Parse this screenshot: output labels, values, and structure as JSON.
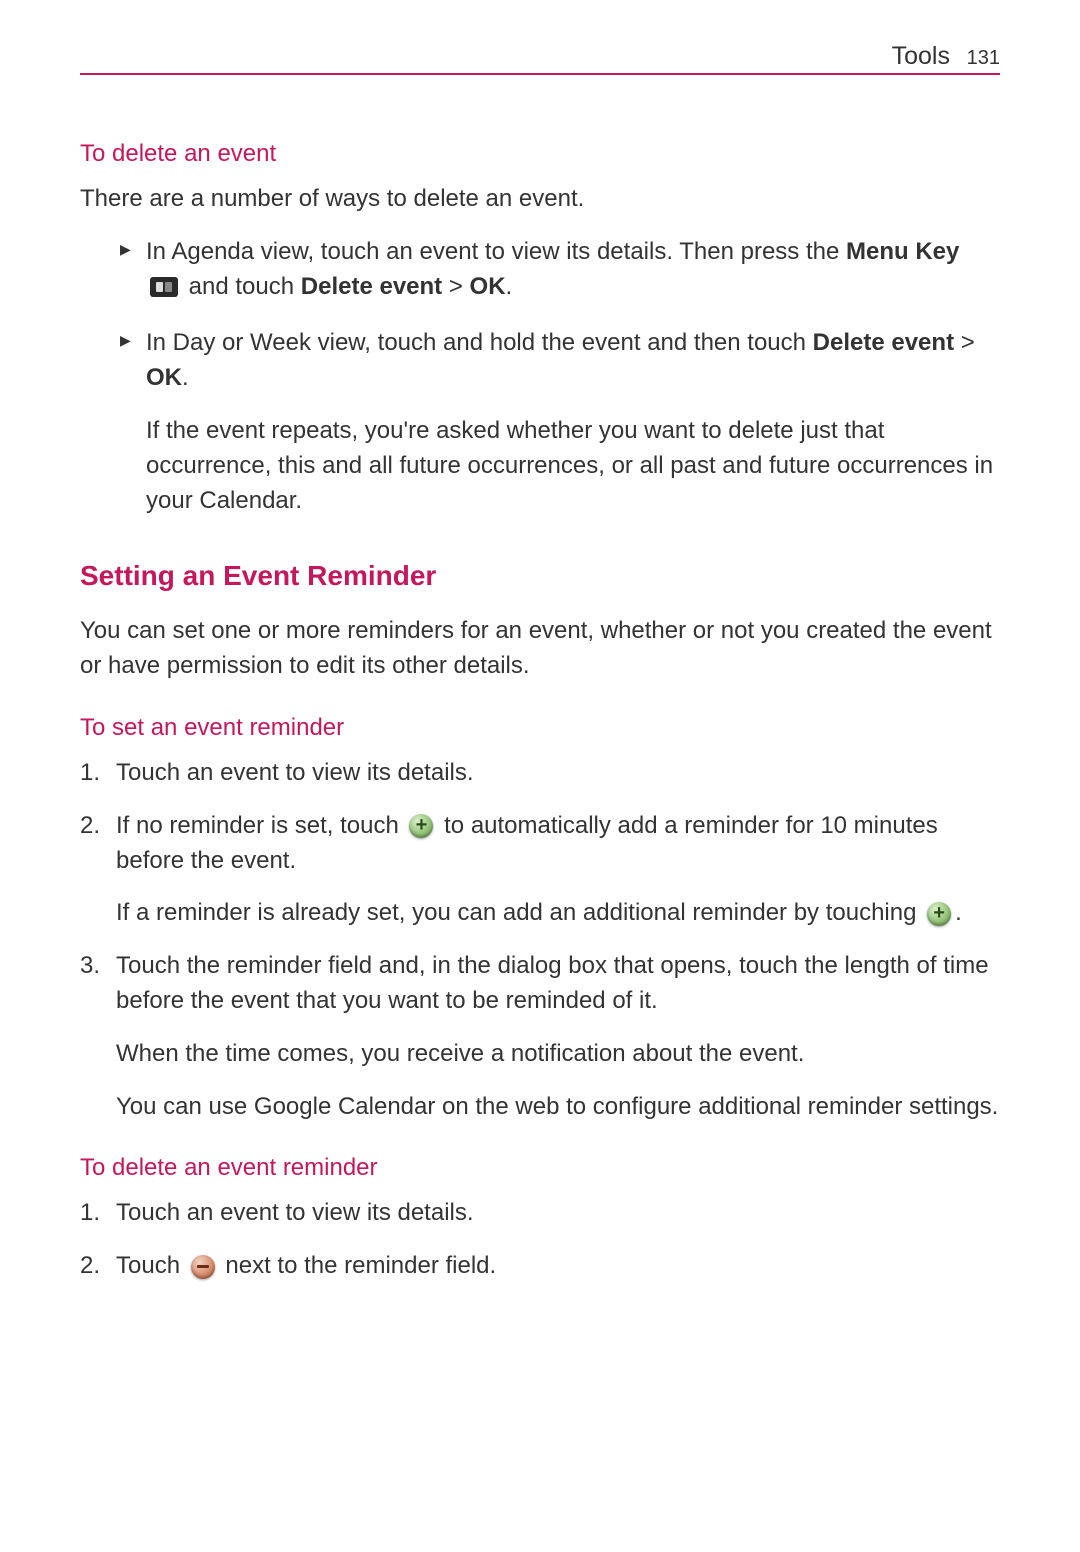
{
  "header": {
    "section": "Tools",
    "page_number": "131"
  },
  "sections": {
    "delete_event": {
      "heading": "To delete an event",
      "intro": "There are a number of ways to delete an event.",
      "bullets": {
        "b1": {
          "p1a": "In Agenda view, touch an event to view its details. Then press the ",
          "p1b": "Menu Key",
          "p1c": " and touch ",
          "p1d": "Delete event",
          "p1e": " > ",
          "p1f": "OK",
          "p1g": "."
        },
        "b2": {
          "p1a": "In Day or Week view, touch and hold the event and then touch ",
          "p1b": "Delete event",
          "p1c": " > ",
          "p1d": "OK",
          "p1e": ".",
          "p2": "If the event repeats, you're asked whether you want to delete just that occurrence, this and all future occurrences, or all past and future occurrences in your Calendar."
        }
      }
    },
    "setting_reminder": {
      "heading": "Setting an Event Reminder",
      "intro": "You can set one or more reminders for an event, whether or not you created the event or have permission to edit its other details."
    },
    "set_reminder": {
      "heading": "To set an event reminder",
      "items": {
        "i1": "Touch an event to view its details.",
        "i2": {
          "p1a": "If no reminder is set, touch ",
          "p1b": " to automatically add a reminder for 10 minutes before the event.",
          "p2a": "If a reminder is already set, you can add an additional reminder by touching ",
          "p2b": "."
        },
        "i3": {
          "p1": "Touch the reminder field and, in the dialog box that opens, touch the length of time before the event that you want to be reminded of it.",
          "p2": "When the time comes, you receive a notification about the event.",
          "p3": "You can use Google Calendar on the web to configure additional reminder settings."
        }
      }
    },
    "delete_reminder": {
      "heading": "To delete an event reminder",
      "items": {
        "i1": "Touch an event to view its details.",
        "i2": {
          "p1a": "Touch ",
          "p1b": " next to the reminder field."
        }
      }
    }
  }
}
